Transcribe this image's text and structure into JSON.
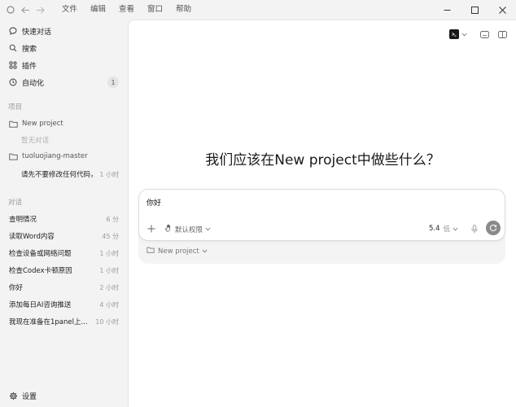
{
  "titlebar": {
    "menu": [
      "文件",
      "编辑",
      "查看",
      "窗口",
      "帮助"
    ]
  },
  "sidebar": {
    "nav": [
      {
        "label": "快速对话",
        "icon": "chat-bubble-icon"
      },
      {
        "label": "搜索",
        "icon": "search-icon"
      },
      {
        "label": "插件",
        "icon": "grid-icon"
      },
      {
        "label": "自动化",
        "icon": "clock-icon",
        "badge": "1"
      }
    ],
    "projects_header": "项目",
    "projects": [
      {
        "name": "New project",
        "empty_text": "暂无对话",
        "threads": []
      },
      {
        "name": "tuoluojiang-master",
        "threads": [
          {
            "title": "请先不要修改任何代码，先...",
            "time": "1 小时"
          }
        ]
      }
    ],
    "chats_header": "对话",
    "chats": [
      {
        "title": "查明情况",
        "time": "6 分"
      },
      {
        "title": "读取Word内容",
        "time": "45 分"
      },
      {
        "title": "检查设备或网络问题",
        "time": "1 小时"
      },
      {
        "title": "检查Codex卡顿原因",
        "time": "1 小时"
      },
      {
        "title": "你好",
        "time": "2 小时"
      },
      {
        "title": "添加每日AI咨询推送",
        "time": "4 小时"
      },
      {
        "title": "我现在准备在1panel上...",
        "time": "10 小时"
      }
    ],
    "settings_label": "设置"
  },
  "main": {
    "heading": "我们应该在New project中做些什么？",
    "composer": {
      "text": "你好",
      "permission_label": "默认权限",
      "model_version": "5.4",
      "model_level": "低"
    },
    "project_selector": "New project"
  },
  "colors": {
    "sidebar_bg": "#f3f3f3",
    "main_bg": "#ffffff",
    "send_button": "#8a8a8a"
  }
}
